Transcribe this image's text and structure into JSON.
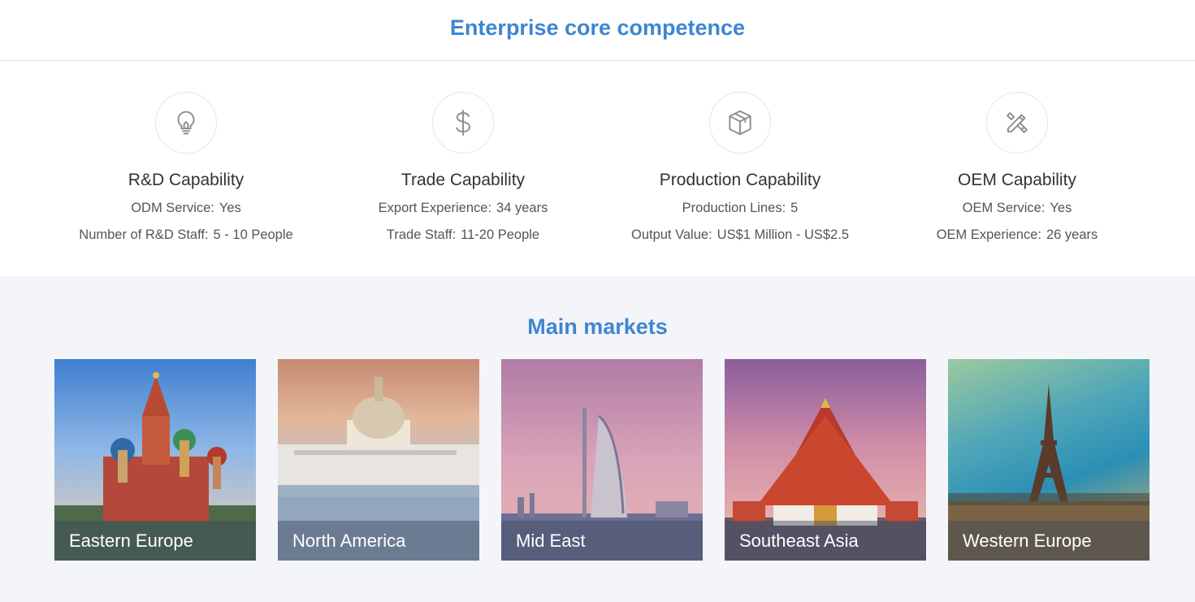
{
  "competence": {
    "title": "Enterprise core competence",
    "items": [
      {
        "icon": "lightbulb-icon",
        "title": "R&D Capability",
        "rows": [
          {
            "k": "ODM Service:",
            "v": "Yes"
          },
          {
            "k": "Number of R&D Staff:",
            "v": "5 - 10 People"
          }
        ]
      },
      {
        "icon": "dollar-icon",
        "title": "Trade Capability",
        "rows": [
          {
            "k": "Export Experience:",
            "v": "34 years"
          },
          {
            "k": "Trade Staff:",
            "v": "11-20 People"
          }
        ]
      },
      {
        "icon": "box-icon",
        "title": "Production Capability",
        "rows": [
          {
            "k": "Production Lines:",
            "v": "5"
          },
          {
            "k": "Output Value:",
            "v": "US$1 Million - US$2.5"
          }
        ]
      },
      {
        "icon": "design-tools-icon",
        "title": "OEM Capability",
        "rows": [
          {
            "k": "OEM Service:",
            "v": "Yes"
          },
          {
            "k": "OEM Experience:",
            "v": "26 years"
          }
        ]
      }
    ]
  },
  "markets": {
    "title": "Main markets",
    "items": [
      {
        "label": "Eastern Europe",
        "image": "st-basils-cathedral"
      },
      {
        "label": "North America",
        "image": "us-capitol"
      },
      {
        "label": "Mid East",
        "image": "burj-al-arab"
      },
      {
        "label": "Southeast Asia",
        "image": "thai-temple"
      },
      {
        "label": "Western Europe",
        "image": "eiffel-tower"
      }
    ]
  },
  "colors": {
    "accent": "#3d86d1",
    "market_bg": "#f3f5f9"
  }
}
